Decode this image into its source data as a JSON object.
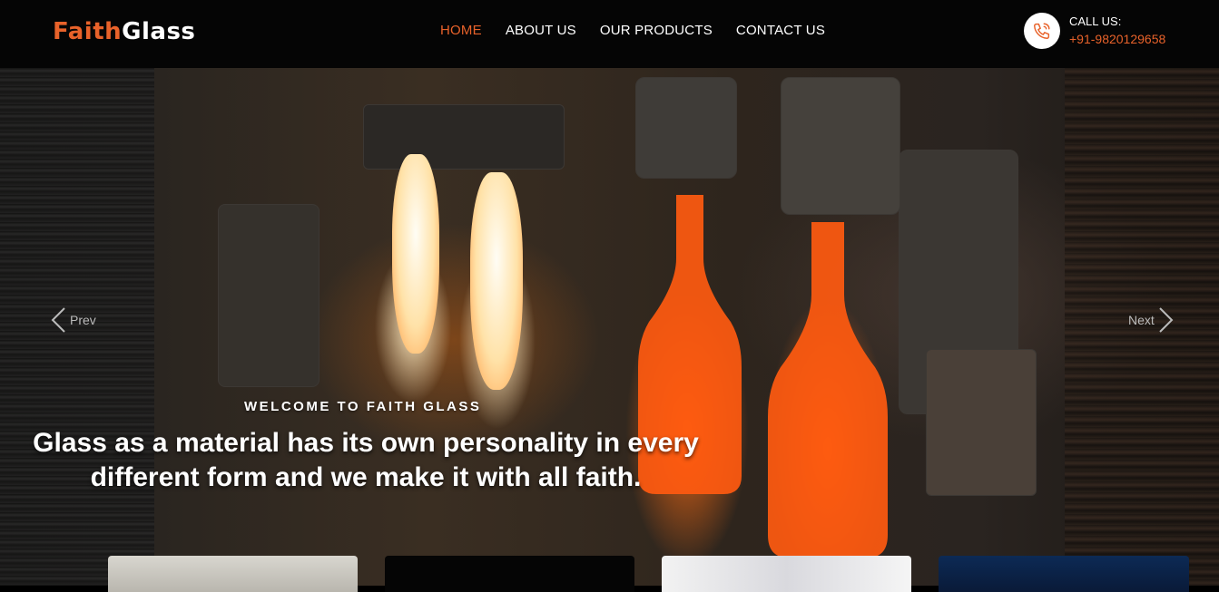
{
  "header": {
    "logo_part1": "Faith",
    "logo_part2": "Glass",
    "nav": [
      {
        "label": "HOME",
        "active": true
      },
      {
        "label": "ABOUT US",
        "active": false
      },
      {
        "label": "OUR PRODUCTS",
        "active": false
      },
      {
        "label": "CONTACT US",
        "active": false
      }
    ],
    "call_label": "CALL US:",
    "call_number": "+91-9820129658",
    "call_icon": "phone-icon"
  },
  "hero": {
    "prev_label": "Prev",
    "next_label": "Next",
    "welcome": "WELCOME TO FAITH GLASS",
    "headline": "Glass as a material has its own personality in every different form and we make it with all faith."
  },
  "colors": {
    "accent": "#e8622a",
    "header_bg": "#050505",
    "text": "#ffffff"
  }
}
